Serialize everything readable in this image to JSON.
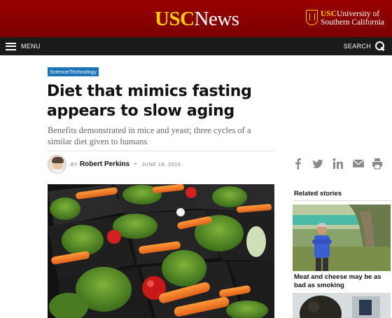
{
  "header": {
    "logo_usc": "USC",
    "logo_news": "News",
    "university_usc": "USC",
    "university_line1": "University of",
    "university_line2": "Southern California"
  },
  "nav": {
    "menu_label": "MENU",
    "search_label": "SEARCH"
  },
  "article": {
    "category": "Science/Technology",
    "title": "Diet that mimics fasting appears to slow aging",
    "subtitle": "Benefits demonstrated in mice and yeast; three cycles of a similar diet given to humans",
    "by_prefix": "BY",
    "author": "Robert Perkins",
    "separator": "•",
    "date": "JUNE 18, 2015"
  },
  "share_icons": [
    "facebook-icon",
    "twitter-icon",
    "linkedin-icon",
    "email-icon",
    "print-icon"
  ],
  "related": {
    "heading": "Related stories",
    "items": [
      {
        "title": "Meat and cheese may be as bad as smoking"
      }
    ]
  },
  "colors": {
    "header_red": "#990000",
    "usc_gold": "#ffcc00",
    "nav_dark": "#1a1a1a",
    "category_blue": "#1a73b8"
  }
}
